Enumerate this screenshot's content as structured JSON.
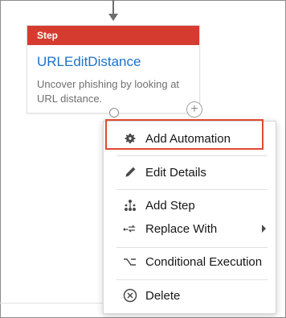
{
  "step": {
    "badge": "Step",
    "title": "URLEditDistance",
    "description": "Uncover phishing by looking at URL distance."
  },
  "add_circle_glyph": "+",
  "menu": {
    "items": [
      {
        "label": "Add Automation",
        "icon": "gear-icon"
      },
      {
        "label": "Edit Details",
        "icon": "pencil-icon"
      },
      {
        "label": "Add Step",
        "icon": "tree-icon"
      },
      {
        "label": "Replace With",
        "icon": "replace-icon",
        "has_submenu": true
      },
      {
        "label": "Conditional Execution",
        "icon": "branch-icon"
      },
      {
        "label": "Delete",
        "icon": "delete-circle-icon"
      }
    ]
  },
  "colors": {
    "step_header": "#d63b2f",
    "step_title": "#1a73c9",
    "highlight": "#e14a2f"
  }
}
